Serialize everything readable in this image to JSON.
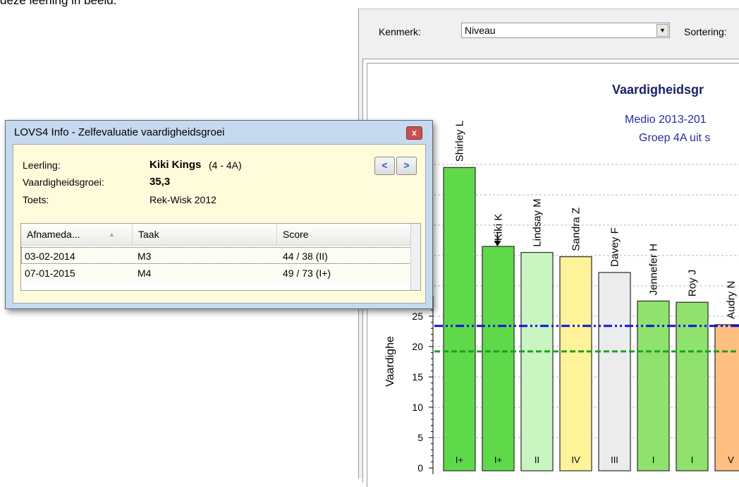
{
  "intro_text": "deze leerling in beeld.",
  "toolbar": {
    "kenmerk_label": "Kenmerk:",
    "kenmerk_value": "Niveau",
    "sortering_label": "Sortering:"
  },
  "chart_data": {
    "type": "bar",
    "title": "Vaardigheidsgr",
    "subtitle_lines": [
      "Medio 2013-201",
      "Groep 4A uit s"
    ],
    "ylabel": "Vaardighe",
    "ylim": [
      0,
      40
    ],
    "yticks": [
      "0",
      "5",
      "10",
      "15",
      "20",
      "25"
    ],
    "categories": [
      "Shirley L",
      "Kiki K",
      "Lindsay M",
      "Sandra Z",
      "Davey F",
      "Jennefer H",
      "Roy J",
      "Audry N"
    ],
    "levels": [
      "I+",
      "I+",
      "II",
      "IV",
      "III",
      "I",
      "I",
      "V"
    ],
    "values": [
      49.5,
      36.5,
      35.5,
      34.8,
      32.2,
      27.5,
      27.3,
      23.6
    ],
    "bar_colors": [
      "#5fd94a",
      "#5fd94a",
      "#c9f5c1",
      "#fff39a",
      "#ececec",
      "#8fe26d",
      "#8fe26d",
      "#ffbf80"
    ],
    "reference_lines": [
      {
        "value": 23.4,
        "color": "#1010e0",
        "style": "dash-dot"
      },
      {
        "value": 19.2,
        "color": "#1fa01f",
        "style": "dashed"
      }
    ],
    "marked_category": "Kiki K",
    "grid": true
  },
  "dialog": {
    "title": "LOVS4 Info - Zelfevaluatie vaardigheidsgroei",
    "close_label": "x",
    "leerling_label": "Leerling:",
    "leerling_name": "Kiki Kings",
    "leerling_extra": "(4 - 4A)",
    "groei_label": "Vaardigheidsgroei:",
    "groei_value": "35,3",
    "toets_label": "Toets:",
    "toets_value": "Rek-Wisk 2012",
    "prev_label": "<",
    "next_label": ">",
    "columns": [
      "Afnameda...",
      "Taak",
      "Score"
    ],
    "rows": [
      {
        "date": "03-02-2014",
        "taak": "M3",
        "score": "44 / 38 (II)"
      },
      {
        "date": "07-01-2015",
        "taak": "M4",
        "score": "49 / 73 (I+)"
      }
    ]
  }
}
